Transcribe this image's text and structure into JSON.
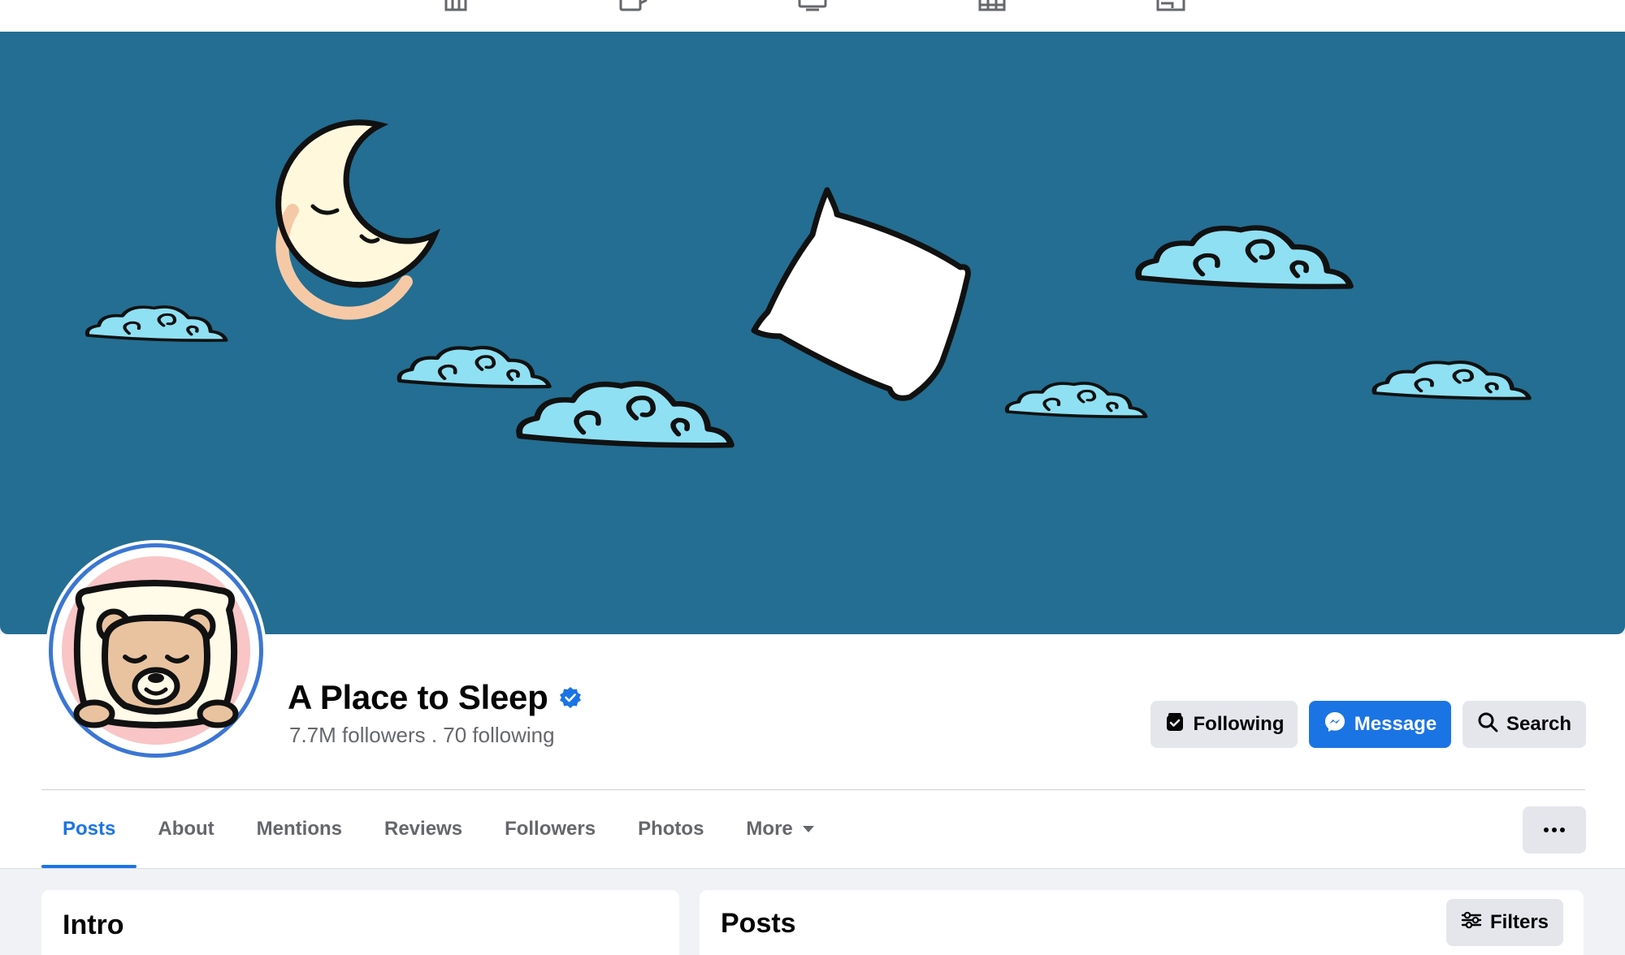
{
  "top_nav": {
    "icons": [
      "home-icon",
      "video-icon",
      "tv-icon",
      "marketplace-icon",
      "gaming-icon"
    ]
  },
  "cover": {
    "description_icons": [
      "sleepy-moon",
      "pillow",
      "clouds"
    ]
  },
  "profile": {
    "name": "A Place to Sleep",
    "verified": true,
    "stats": "7.7M followers . 70 following"
  },
  "actions": {
    "following_label": "Following",
    "message_label": "Message",
    "search_label": "Search"
  },
  "tabs": [
    {
      "label": "Posts",
      "active": true
    },
    {
      "label": "About",
      "active": false
    },
    {
      "label": "Mentions",
      "active": false
    },
    {
      "label": "Reviews",
      "active": false
    },
    {
      "label": "Followers",
      "active": false
    },
    {
      "label": "Photos",
      "active": false
    },
    {
      "label": "More",
      "active": false
    }
  ],
  "intro": {
    "title": "Intro"
  },
  "posts": {
    "title": "Posts",
    "filters_label": "Filters"
  },
  "colors": {
    "accent": "#1b74e4",
    "cover_bg": "#236e92",
    "cloud": "#8fe0f3",
    "avatar_ring": "#3b76d3"
  }
}
